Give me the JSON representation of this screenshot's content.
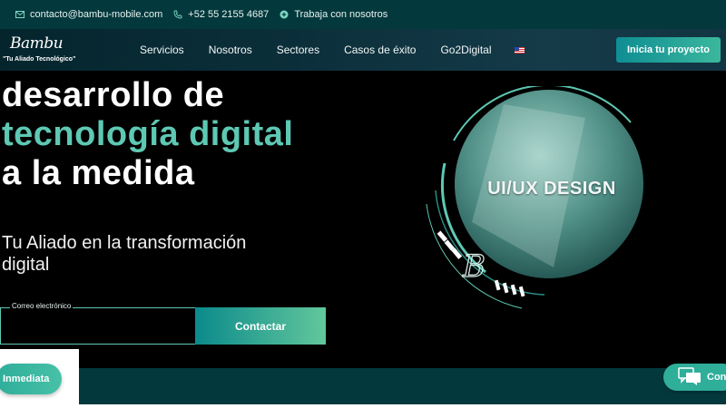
{
  "topbar": {
    "email": "contacto@bambu-mobile.com",
    "phone": "+52 55 2155 4687",
    "jobs": "Trabaja con nosotros"
  },
  "nav": {
    "logo_script": "Bambu",
    "logo_tagline": "\"Tu Aliado Tecnológico\"",
    "items": [
      {
        "label": "Servicios"
      },
      {
        "label": "Nosotros"
      },
      {
        "label": "Sectores"
      },
      {
        "label": "Casos de éxito"
      },
      {
        "label": "Go2Digital"
      }
    ],
    "language_flag": "us-flag-icon",
    "cta": "Inicia tu proyecto"
  },
  "hero": {
    "line1": "desarrollo de",
    "line2": "tecnología digital",
    "line3": "a la medida",
    "subtitle": "Tu Aliado en la transformación digital",
    "email_label": "Correo electrónico",
    "email_value": "",
    "contact_button": "Contactar",
    "visual_label": "UI/UX DESIGN"
  },
  "floating": {
    "left_pill": "Inmediata",
    "right_pill": "Con"
  },
  "colors": {
    "accent": "#5ec8b3",
    "topbar": "#03393d",
    "button_gradient_start": "#0b8a8b",
    "button_gradient_end": "#62c79c"
  }
}
